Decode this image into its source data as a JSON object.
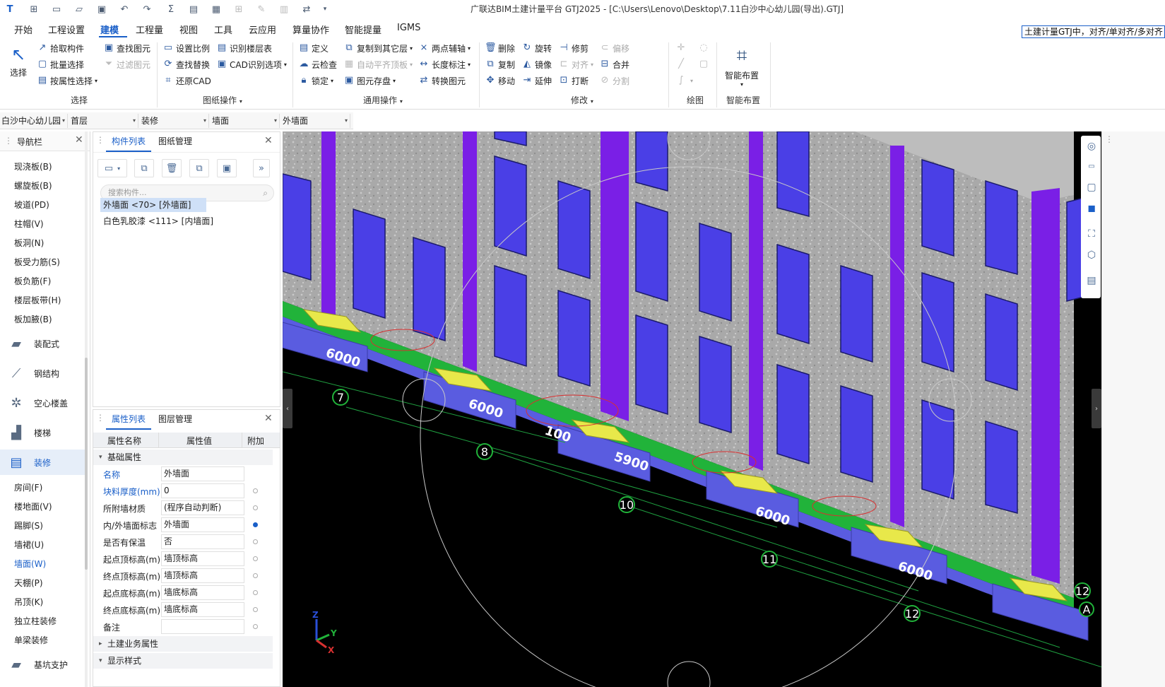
{
  "app": {
    "title": "广联达BIM土建计量平台 GTJ2025 - [C:\\Users\\Lenovo\\Desktop\\7.11白沙中心幼儿园(导出).GTJ]"
  },
  "menu": [
    "开始",
    "工程设置",
    "建模",
    "工程量",
    "视图",
    "工具",
    "云应用",
    "算量协作",
    "智能提量",
    "IGMS"
  ],
  "hint": "土建计量GTJ中，对齐/单对齐/多对齐",
  "ribbon": {
    "select": {
      "big": "选择",
      "items": [
        "拾取构件",
        "批量选择",
        "按属性选择",
        "查找图元",
        "过滤图元"
      ],
      "label": "选择"
    },
    "drawing": {
      "items": [
        "设置比例",
        "识别楼层表",
        "查找替换",
        "CAD识别选项",
        "还原CAD"
      ],
      "label": "图纸操作"
    },
    "common": {
      "items": [
        "定义",
        "复制到其它层",
        "两点辅轴",
        "云检查",
        "自动平齐顶板",
        "长度标注",
        "锁定",
        "图元存盘",
        "转换图元"
      ],
      "label": "通用操作"
    },
    "modify": {
      "items": [
        "删除",
        "旋转",
        "修剪",
        "偏移",
        "复制",
        "镜像",
        "对齐",
        "合并",
        "移动",
        "延伸",
        "打断",
        "分割"
      ],
      "label": "修改"
    },
    "draw": {
      "label": "绘图"
    },
    "smart": {
      "big": "智能布置",
      "label": "智能布置"
    }
  },
  "context": [
    "白沙中心幼儿园",
    "首层",
    "装修",
    "墙面",
    "外墙面"
  ],
  "nav": {
    "title": "导航栏",
    "items_top": [
      "现浇板(B)",
      "螺旋板(B)",
      "坡道(PD)",
      "柱帽(V)",
      "板洞(N)",
      "板受力筋(S)",
      "板负筋(F)",
      "楼层板带(H)",
      "板加腋(B)"
    ],
    "cats": [
      "装配式",
      "钢结构",
      "空心楼盖",
      "楼梯",
      "装修"
    ],
    "items_bottom": [
      "房间(F)",
      "楼地面(V)",
      "踢脚(S)",
      "墙裙(U)",
      "墙面(W)",
      "天棚(P)",
      "吊顶(K)",
      "独立柱装修",
      "单梁装修",
      "基坑支护"
    ]
  },
  "components": {
    "tabs": [
      "构件列表",
      "图纸管理"
    ],
    "search_placeholder": "搜索构件...",
    "items": [
      "外墙面 <70> [外墙面]",
      "白色乳胶漆 <111> [内墙面]"
    ]
  },
  "properties": {
    "tabs": [
      "属性列表",
      "图层管理"
    ],
    "headers": [
      "属性名称",
      "属性值",
      "附加"
    ],
    "section_basic": "基础属性",
    "rows": [
      {
        "name": "名称",
        "value": "外墙面"
      },
      {
        "name": "块料厚度(mm)",
        "value": "0"
      },
      {
        "name": "所附墙材质",
        "value": "(程序自动判断)"
      },
      {
        "name": "内/外墙面标志",
        "value": "外墙面"
      },
      {
        "name": "是否有保温",
        "value": "否"
      },
      {
        "name": "起点顶标高(m)",
        "value": "墙顶标高"
      },
      {
        "name": "终点顶标高(m)",
        "value": "墙顶标高"
      },
      {
        "name": "起点底标高(m)",
        "value": "墙底标高"
      },
      {
        "name": "终点底标高(m)",
        "value": "墙底标高"
      },
      {
        "name": "备注",
        "value": ""
      }
    ],
    "section_civil": "土建业务属性",
    "section_display": "显示样式"
  },
  "viewport": {
    "dims": [
      "6000",
      "6000",
      "100",
      "5900",
      "6000",
      "6000"
    ],
    "axes": [
      "7",
      "8",
      "10",
      "11",
      "12",
      "12",
      "A"
    ],
    "axis_labels": [
      "Z",
      "Y",
      "X"
    ]
  },
  "colors": {
    "accent": "#1a5fc8",
    "purple": "#7a1fe6",
    "window": "#4a3fe6",
    "green": "#21b33a",
    "slab": "#5a5ce0",
    "yellow": "#e8e84a"
  }
}
